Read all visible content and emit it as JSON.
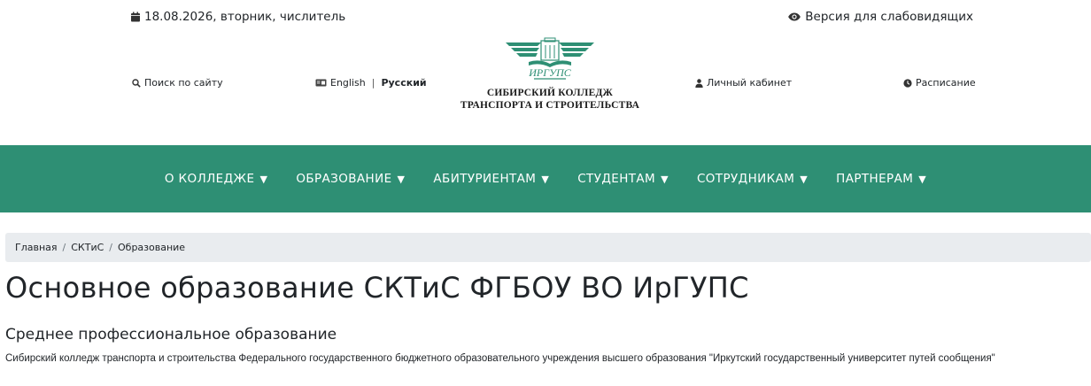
{
  "topbar": {
    "date": "18.08.2026, вторник, числитель",
    "vision_label": "Версия для слабовидящих",
    "date_icon": "calendar-icon",
    "vision_icon": "eye-icon"
  },
  "header": {
    "search_label": "Поиск по сайту",
    "lang_english": "English",
    "lang_separator": "|",
    "lang_russian": "Русский",
    "cabinet_label": "Личный кабинет",
    "schedule_label": "Расписание",
    "logo_brand": "ИРГУПС",
    "logo_line1": "СИБИРСКИЙ КОЛЛЕДЖ",
    "logo_line2": "ТРАНСПОРТА И СТРОИТЕЛЬСТВА"
  },
  "nav": {
    "items": [
      {
        "label": "О КОЛЛЕДЖЕ",
        "caret": "▼"
      },
      {
        "label": "ОБРАЗОВАНИЕ",
        "caret": "▼"
      },
      {
        "label": "АБИТУРИЕНТАМ",
        "caret": "▼"
      },
      {
        "label": "СТУДЕНТАМ",
        "caret": "▼"
      },
      {
        "label": "СОТРУДНИКАМ",
        "caret": "▼"
      },
      {
        "label": "ПАРТНЕРАМ",
        "caret": "▼"
      }
    ]
  },
  "breadcrumb": {
    "items": [
      "Главная",
      "СКТиС",
      "Образование"
    ],
    "separator": "/"
  },
  "main": {
    "title": "Основное образование СКТиС ФГБОУ ВО ИрГУПС",
    "subtitle": "Среднее профессиональное образование",
    "description": "Сибирский колледж транспорта и строительства Федерального государственного бюджетного образовательного учреждения высшего образования \"Иркутский государственный университет путей сообщения\""
  },
  "colors": {
    "nav_bg": "#2e8f74",
    "logo_green": "#2e8f74",
    "breadcrumb_bg": "#e9ecef"
  }
}
